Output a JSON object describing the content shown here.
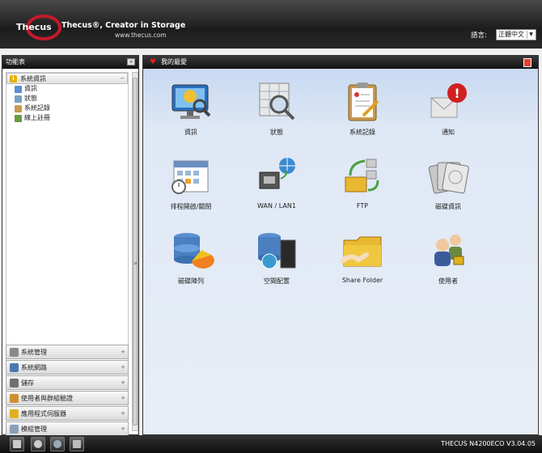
{
  "header": {
    "brand": "Thecus",
    "tagline": "Thecus®, Creator in Storage",
    "site": "www.thecus.com",
    "language_label": "語言:",
    "language_value": "正體中文"
  },
  "sidebar": {
    "title": "功能表",
    "active_group": "系統資訊",
    "sub_items": [
      {
        "label": "資訊",
        "icon": "info-icon"
      },
      {
        "label": "狀態",
        "icon": "status-icon"
      },
      {
        "label": "系統記錄",
        "icon": "log-icon"
      },
      {
        "label": "線上註冊",
        "icon": "register-icon"
      }
    ],
    "groups": [
      {
        "label": "系統管理",
        "icon": "tools-icon"
      },
      {
        "label": "系統網路",
        "icon": "network-icon"
      },
      {
        "label": "儲存",
        "icon": "storage-icon"
      },
      {
        "label": "使用者與群組驗證",
        "icon": "users-icon"
      },
      {
        "label": "應用程式伺服器",
        "icon": "app-server-icon"
      },
      {
        "label": "模組管理",
        "icon": "module-icon"
      }
    ]
  },
  "main": {
    "title": "我的最愛",
    "tiles": [
      {
        "label": "資訊",
        "icon": "info-monitor-icon"
      },
      {
        "label": "狀態",
        "icon": "status-magnifier-icon"
      },
      {
        "label": "系統記錄",
        "icon": "clipboard-log-icon"
      },
      {
        "label": "通知",
        "icon": "notification-icon"
      },
      {
        "label": "排程開啟/關閉",
        "icon": "calendar-icon"
      },
      {
        "label": "WAN / LAN1",
        "icon": "network-port-icon"
      },
      {
        "label": "FTP",
        "icon": "ftp-icon"
      },
      {
        "label": "磁碟資訊",
        "icon": "disk-info-icon"
      },
      {
        "label": "磁碟陣列",
        "icon": "raid-icon"
      },
      {
        "label": "空間配置",
        "icon": "space-allocation-icon"
      },
      {
        "label": "Share Folder",
        "icon": "share-folder-icon"
      },
      {
        "label": "使用者",
        "icon": "users-icon"
      }
    ]
  },
  "footer": {
    "version": "THECUS N4200ECO V3.04.05",
    "buttons": [
      "shutdown-icon",
      "disk-icon",
      "restart-icon",
      "network-tree-icon"
    ]
  },
  "colors": {
    "accent": "#e02020",
    "header_bg": "#1c1c1c",
    "panel_bg": "#dfe8f5"
  }
}
